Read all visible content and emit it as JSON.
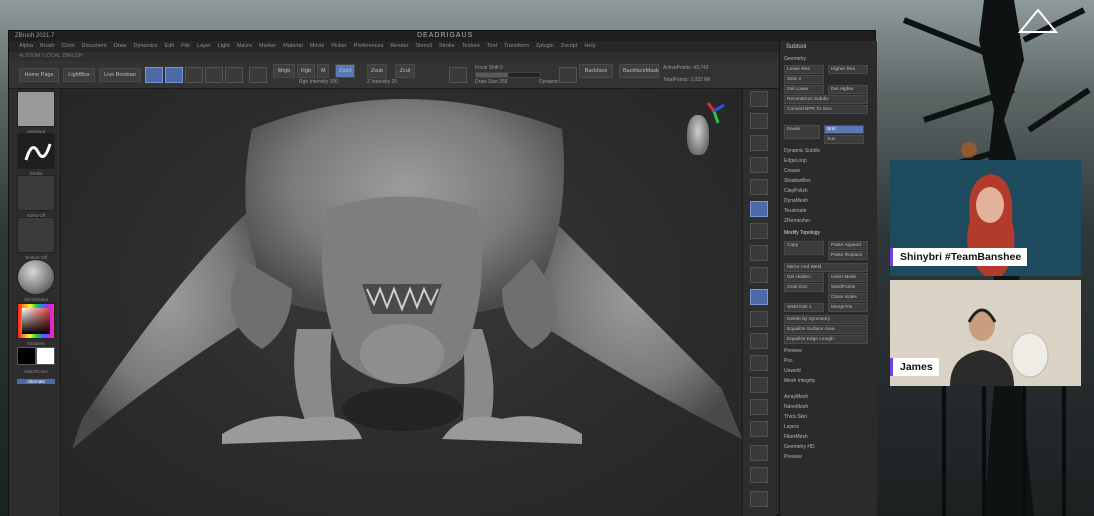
{
  "stream": {
    "logo_icon": "triangle-logo-icon"
  },
  "window": {
    "title": "ZBrush 2021.7",
    "center_title": "DEADRIGAUS"
  },
  "menu": {
    "items": [
      "Alpha",
      "Brush",
      "Color",
      "Document",
      "Draw",
      "Dynamics",
      "Edit",
      "File",
      "Layer",
      "Light",
      "Macro",
      "Marker",
      "Material",
      "Movie",
      "Picker",
      "Preferences",
      "Render",
      "Stencil",
      "Stroke",
      "Texture",
      "Tool",
      "Transform",
      "Zplugin",
      "Zscript",
      "Help"
    ]
  },
  "subbar": {
    "text": "AI ZOOM / LOCAL ZBRUSH"
  },
  "toolbar": {
    "home_page": "Home Page",
    "lightbox": "LightBox",
    "live_boolean": "Live Boolean",
    "mrgb": "Mrgb",
    "rgb": "Rgb",
    "m": "M",
    "zadd": "Zadd",
    "zsub": "Zsub",
    "zcut": "Zcut",
    "focal_shift": "Focal Shift 0",
    "draw_size": "Draw Size 256",
    "dynamic": "Dynamic",
    "backface": "Backface",
    "backfacemask": "BackfaceMask",
    "active_points": "ActivePoints: 43,743",
    "total_points": "TotalPoints: 2,032 Mil",
    "rgb_intensity": "Rgb Intensity 100",
    "z_intensity": "Z Intensity 25"
  },
  "left_tray": {
    "items": [
      "Standard",
      "Stroke",
      "Alpha Off",
      "Texture Off",
      "SkinShade4",
      "Gradient",
      "SwitchColor",
      "Alternate"
    ]
  },
  "canvas": {
    "gizmo_axes": {
      "x": "#e03030",
      "y": "#2fc040",
      "z": "#3050e0"
    }
  },
  "palette": {
    "title": "Subtool",
    "rows": [
      "Geometry",
      "Lower Res",
      "Higher Res",
      "SDiv 2",
      "Del Lower",
      "Del Higher",
      "Reconstruct Subdiv",
      "Convert BPR To Geo",
      "Divide",
      "Smt",
      "Suv",
      "Dynamic Subdiv",
      "EdgeLoop",
      "Crease",
      "ShadowBox",
      "ClayPolish",
      "DynaMesh",
      "Tessimate",
      "ZRemesher",
      "Modify Topology",
      "Copy",
      "Paste Append",
      "Paste Replace",
      "Mirror And Weld",
      "Del Hidden",
      "Insert Mesh",
      "Grab Doc",
      "WeldPoints",
      "Close Holes",
      "Weld Dist 1",
      "MergeTris",
      "Delete by Symmetry",
      "Equalize Surface Area",
      "Equalize Edge Length",
      "Preview",
      "Pos",
      "Unweld",
      "Mesh Integrity",
      "ArrayMesh",
      "NanoMesh",
      "Thick Skin",
      "Layers",
      "FiberMesh",
      "Geometry HD",
      "Preview"
    ],
    "active_button": "Smt"
  },
  "cams": [
    {
      "name": "Shinybri #TeamBanshee",
      "bg": "#1e4a5e"
    },
    {
      "name": "James",
      "bg": "#d9d2c5"
    }
  ]
}
